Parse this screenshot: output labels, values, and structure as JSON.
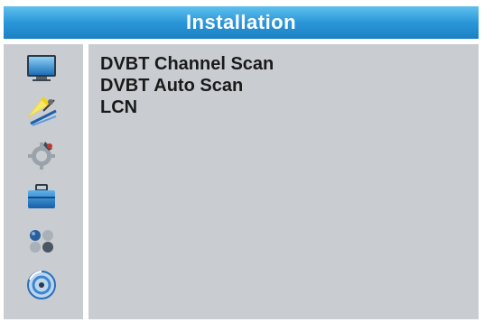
{
  "header": {
    "title": "Installation"
  },
  "sidebar": {
    "items": [
      {
        "icon": "tv-monitor-icon"
      },
      {
        "icon": "installation-satellite-icon"
      },
      {
        "icon": "settings-gear-icon"
      },
      {
        "icon": "toolbox-icon"
      },
      {
        "icon": "game-balls-icon"
      },
      {
        "icon": "media-disc-icon"
      }
    ],
    "selected_index": 1
  },
  "menu": {
    "items": [
      {
        "label": "DVBT Channel Scan"
      },
      {
        "label": "DVBT Auto Scan"
      },
      {
        "label": "LCN"
      }
    ]
  },
  "colors": {
    "title_bar": "#2b97d8",
    "panel_background": "#c9cdd2",
    "text": "#1a1a1a"
  }
}
